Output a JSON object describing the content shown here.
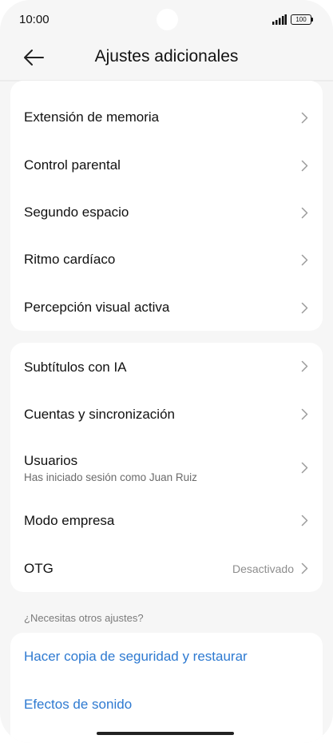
{
  "status_bar": {
    "time": "10:00",
    "battery": "100"
  },
  "header": {
    "title": "Ajustes adicionales",
    "back_icon": "arrow-left-icon"
  },
  "card1": {
    "items": [
      {
        "label": "Extensión de memoria"
      },
      {
        "label": "Control parental"
      },
      {
        "label": "Segundo espacio"
      },
      {
        "label": "Ritmo cardíaco"
      },
      {
        "label": "Percepción visual activa"
      }
    ]
  },
  "card2": {
    "items": [
      {
        "label": "Subtítulos con IA"
      },
      {
        "label": "Cuentas y sincronización"
      },
      {
        "label": "Usuarios",
        "subtitle": "Has iniciado sesión como Juan Ruiz"
      },
      {
        "label": "Modo empresa"
      },
      {
        "label": "OTG",
        "value": "Desactivado"
      }
    ]
  },
  "other_settings": {
    "header": "¿Necesitas otros ajustes?",
    "links": [
      {
        "label": "Hacer copia de seguridad y restaurar"
      },
      {
        "label": "Efectos de sonido"
      }
    ]
  },
  "colors": {
    "link": "#2e7ad1",
    "background": "#f6f6f6",
    "card": "#ffffff"
  }
}
